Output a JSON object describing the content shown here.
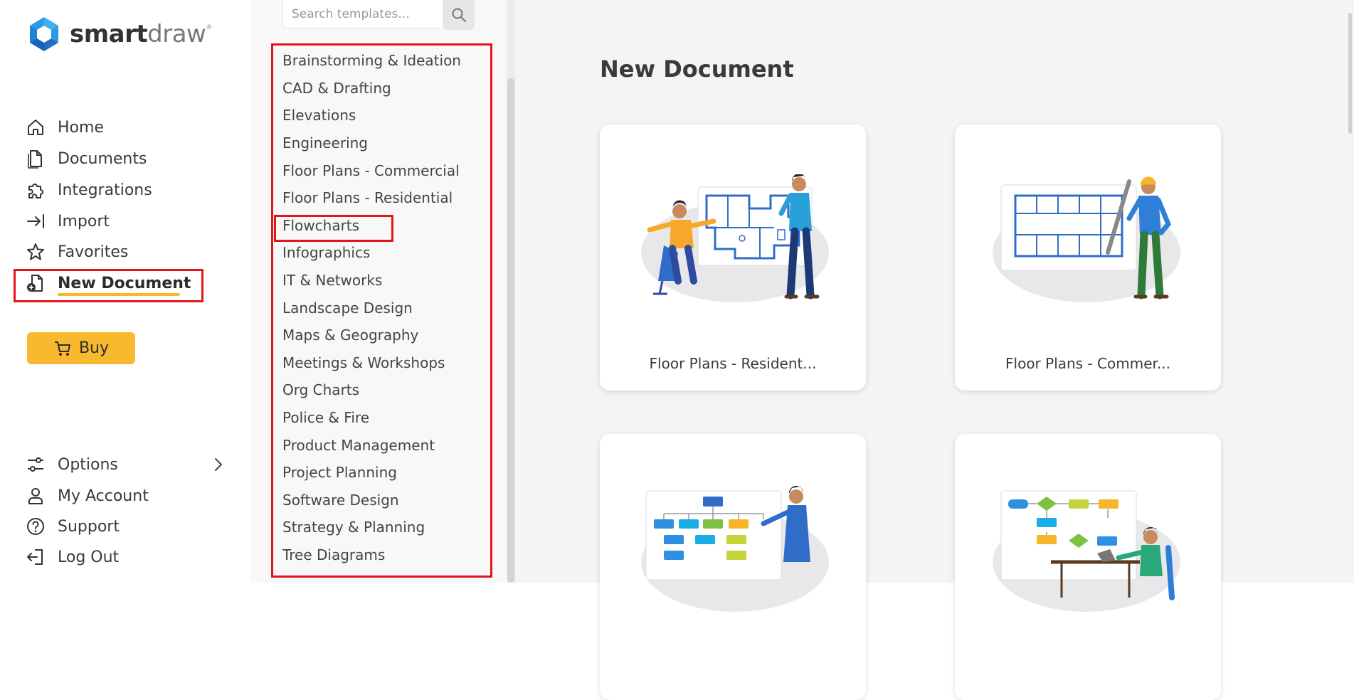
{
  "app": {
    "logo_part1": "smart",
    "logo_part2": "draw",
    "logo_mark": "®",
    "brand_colors": {
      "blue_light": "#2a9ae6",
      "blue_dark": "#1763b8",
      "accent": "#f9b92f",
      "highlight": "#e4141b"
    }
  },
  "sidebar": {
    "items": [
      {
        "label": "Home",
        "icon": "home-icon"
      },
      {
        "label": "Documents",
        "icon": "documents-icon"
      },
      {
        "label": "Integrations",
        "icon": "puzzle-icon"
      },
      {
        "label": "Import",
        "icon": "import-icon"
      },
      {
        "label": "Favorites",
        "icon": "star-icon"
      },
      {
        "label": "New Document",
        "icon": "new-document-icon",
        "active": true
      }
    ],
    "buy_label": "Buy",
    "bottom_items": [
      {
        "label": "Options",
        "icon": "sliders-icon"
      },
      {
        "label": "My Account",
        "icon": "user-icon"
      },
      {
        "label": "Support",
        "icon": "help-icon"
      },
      {
        "label": "Log Out",
        "icon": "logout-icon"
      }
    ]
  },
  "search": {
    "placeholder": "Search templates..."
  },
  "categories": [
    "Brainstorming & Ideation",
    "CAD & Drafting",
    "Elevations",
    "Engineering",
    "Floor Plans - Commercial",
    "Floor Plans - Residential",
    "Flowcharts",
    "Infographics",
    "IT & Networks",
    "Landscape Design",
    "Maps & Geography",
    "Meetings & Workshops",
    "Org Charts",
    "Police & Fire",
    "Product Management",
    "Project Planning",
    "Software Design",
    "Strategy & Planning",
    "Tree Diagrams"
  ],
  "main": {
    "title": "New Document",
    "cards": [
      {
        "caption": "Floor Plans - Resident..."
      },
      {
        "caption": "Floor Plans - Commer..."
      },
      {
        "caption": ""
      },
      {
        "caption": ""
      }
    ]
  }
}
